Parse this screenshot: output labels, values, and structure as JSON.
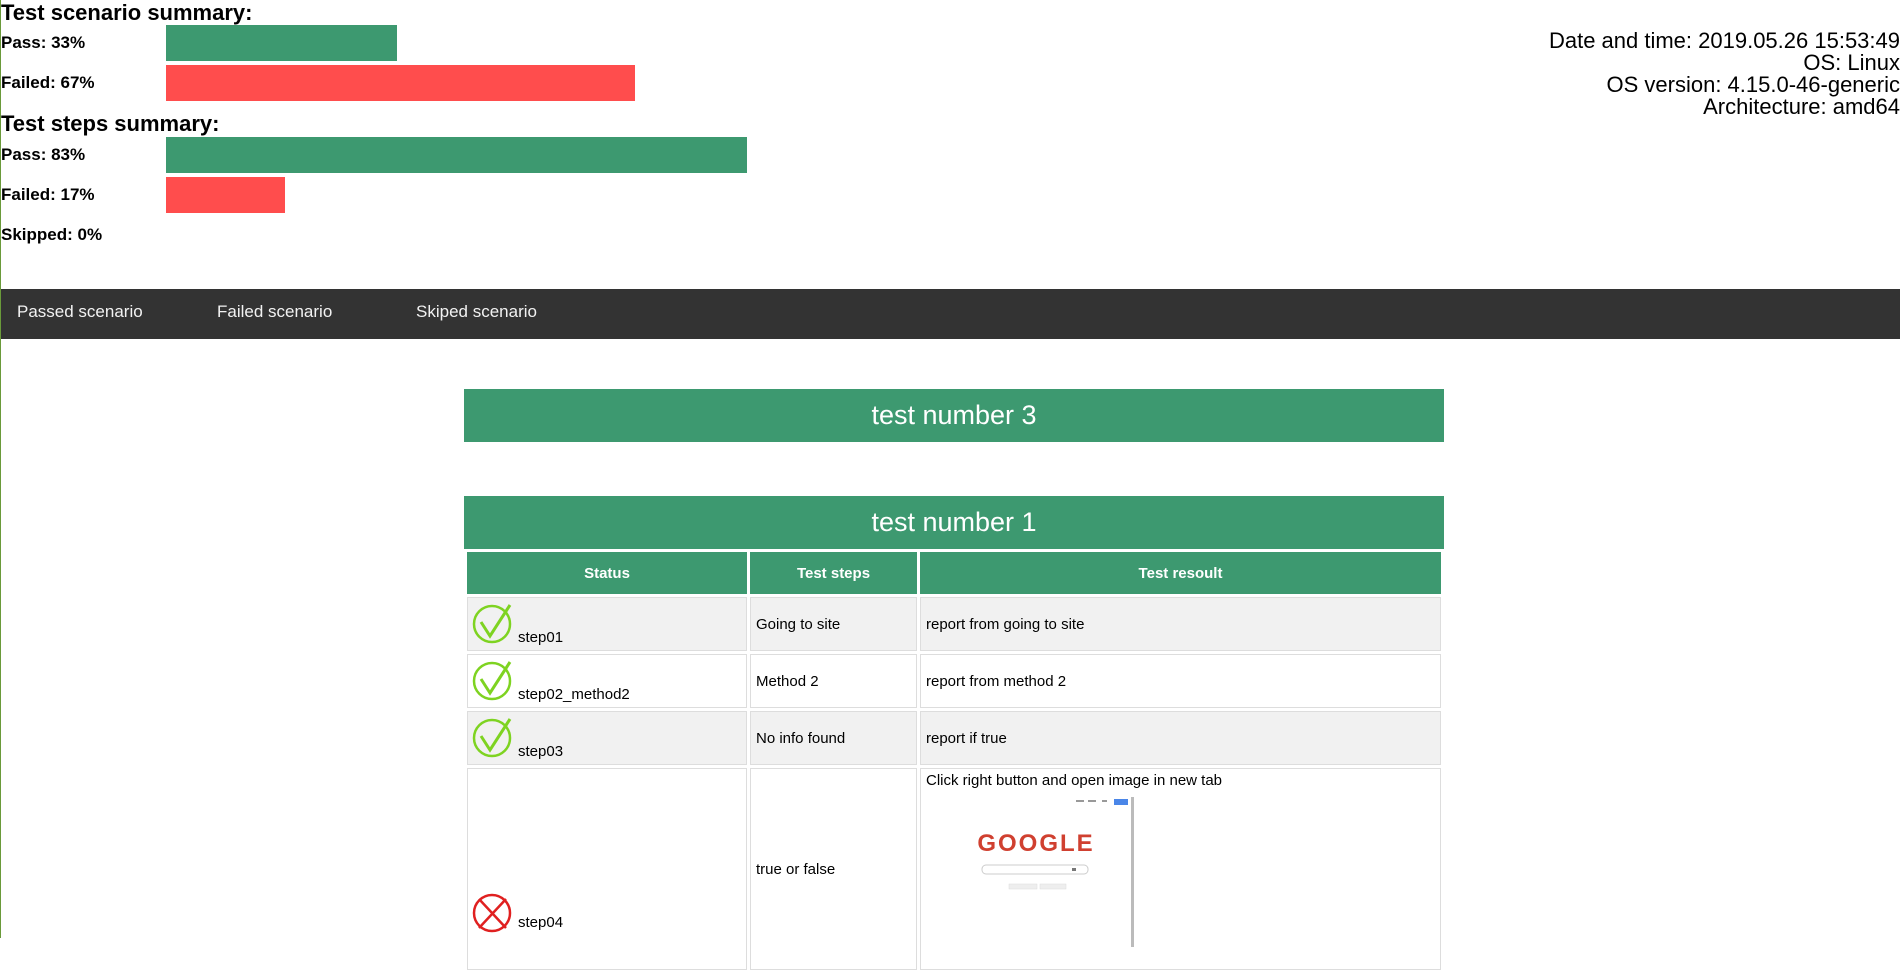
{
  "summary": {
    "scenario_title": "Test scenario summary:",
    "scenario_pass_label": "Pass: 33%",
    "scenario_pass_fraction": 0.33,
    "scenario_failed_label": "Failed: 67%",
    "scenario_failed_fraction": 0.67,
    "steps_title": "Test steps summary:",
    "steps_pass_label": "Pass: 83%",
    "steps_pass_fraction": 0.83,
    "steps_failed_label": "Failed: 17%",
    "steps_failed_fraction": 0.17,
    "steps_skipped_label": "Skipped: 0%",
    "steps_skipped_fraction": 0
  },
  "system": {
    "datetime": "Date and time: 2019.05.26 15:53:49",
    "os": "OS: Linux",
    "os_version": "OS version: 4.15.0-46-generic",
    "architecture": "Architecture: amd64"
  },
  "nav": {
    "passed": "Passed scenario",
    "failed": "Failed scenario",
    "skipped": "Skiped scenario"
  },
  "tests": [
    {
      "title": "test number 3"
    },
    {
      "title": "test number 1",
      "columns": [
        "Status",
        "Test steps",
        "Test resoult"
      ],
      "rows": [
        {
          "status": "pass",
          "step": "step01",
          "description": "Going to site",
          "result": "report from going to site"
        },
        {
          "status": "pass",
          "step": "step02_method2",
          "description": "Method 2",
          "result": "report from method 2"
        },
        {
          "status": "pass",
          "step": "step03",
          "description": "No info found",
          "result": "report if true"
        },
        {
          "status": "fail",
          "step": "step04",
          "description": "true or false",
          "result": "Click right button and open image in new tab"
        }
      ]
    }
  ],
  "screenshot_logo": "GOOGLE",
  "colors": {
    "pass": "#3d9970",
    "fail": "#ff4d4d",
    "nav_bg": "#333333",
    "check_icon": "#7ed321",
    "cross_icon": "#e02020"
  },
  "icons": {
    "pass": "check-circle-icon",
    "fail": "cross-circle-icon"
  }
}
